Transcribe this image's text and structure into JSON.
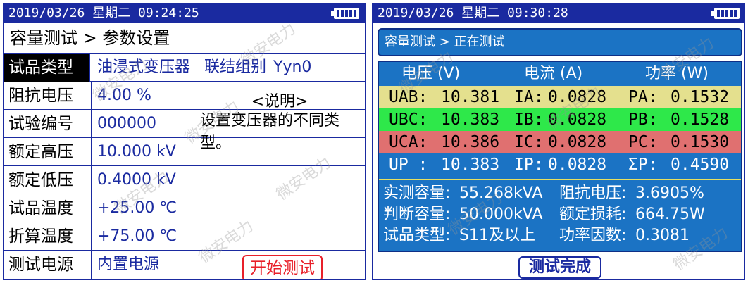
{
  "left": {
    "datetime": "2019/03/26 星期二 09:24:25",
    "title": "容量测试 > 参数设置",
    "sample_type_label": "试品类型",
    "sample_type_value": "油浸式变压器",
    "connection_label": "联结组别",
    "connection_value": "Yyn0",
    "rows": [
      {
        "label": "阻抗电压",
        "value": "4.00 %"
      },
      {
        "label": "试验编号",
        "value": "000000"
      },
      {
        "label": "额定高压",
        "value": "10.000 kV"
      },
      {
        "label": "额定低压",
        "value": "0.4000 kV"
      },
      {
        "label": "试品温度",
        "value": "+25.00 ℃"
      },
      {
        "label": "折算温度",
        "value": "+75.00 ℃"
      },
      {
        "label": "测试电源",
        "value": "内置电源"
      }
    ],
    "explain_title": "<说明>",
    "explain_text": "设置变压器的不同类型。",
    "start_button": "开始测试"
  },
  "right": {
    "datetime": "2019/03/26 星期二 09:30:28",
    "title": "容量测试 > 正在测试",
    "headers": [
      "电压 (V)",
      "电流 (A)",
      "功率 (W)"
    ],
    "rows": [
      {
        "v_label": "UAB:",
        "v": "10.381",
        "i_label": "IA:",
        "i": "0.0828",
        "p_label": "PA:",
        "p": "0.1532"
      },
      {
        "v_label": "UBC:",
        "v": "10.383",
        "i_label": "IB:",
        "i": "0.0828",
        "p_label": "PB:",
        "p": "0.1528"
      },
      {
        "v_label": "UCA:",
        "v": "10.386",
        "i_label": "IC:",
        "i": "0.0828",
        "p_label": "PC:",
        "p": "0.1530"
      },
      {
        "v_label": "UP :",
        "v": "10.383",
        "i_label": "IP:",
        "i": "0.0828",
        "p_label": "ΣP:",
        "p": "0.4590"
      }
    ],
    "summary": [
      {
        "l1": "实测容量:",
        "v1": "55.268kVA",
        "l2": "阻抗电压:",
        "v2": "3.6905%"
      },
      {
        "l1": "判断容量:",
        "v1": "50.000kVA",
        "l2": "额定损耗:",
        "v2": "664.75W"
      },
      {
        "l1": "试品类型:",
        "v1": "S11及以上",
        "l2": "功率因数:",
        "v2": "0.3081"
      }
    ],
    "done_button": "测试完成"
  },
  "watermark": "微安电力",
  "colors": {
    "screen_border": "#1a2aa0",
    "panel_blue": "#1b73c4",
    "row_yellow": "#e4e08e",
    "row_green": "#2ee84a",
    "row_red": "#e07070",
    "start_red": "#e8202a"
  },
  "icons": {
    "battery": "battery-icon"
  }
}
